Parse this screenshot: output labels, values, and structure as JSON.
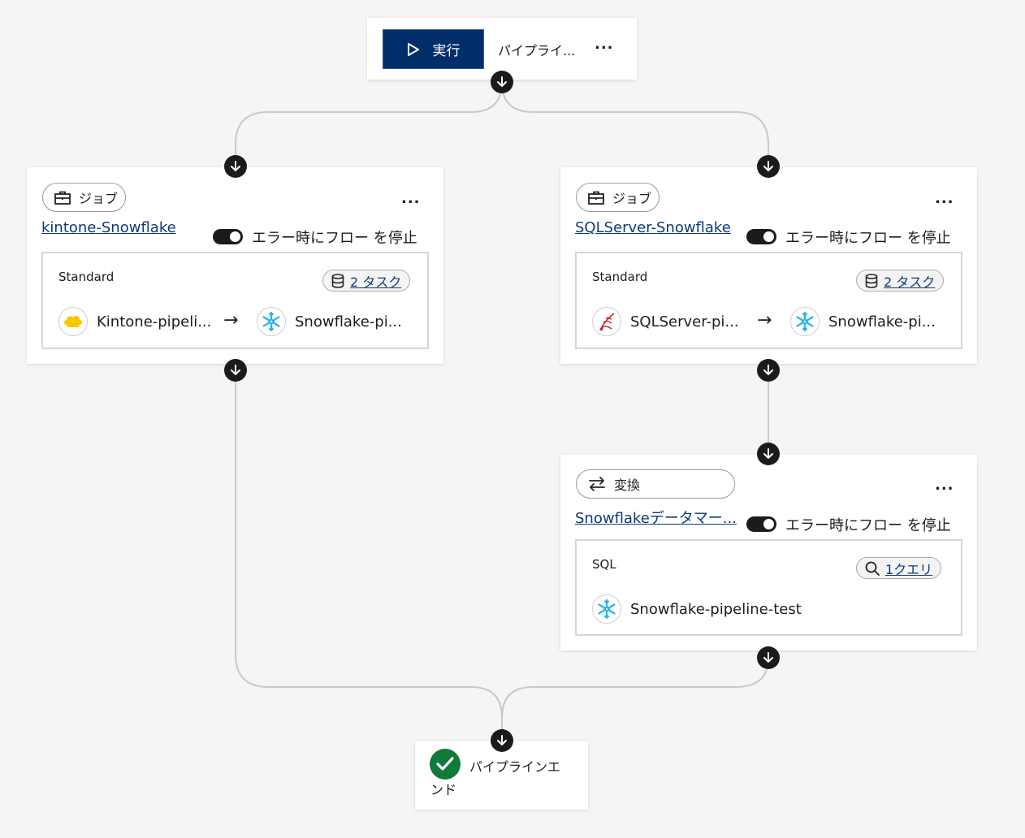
{
  "header": {
    "run_label": "実行",
    "pipeline_name": "パイプライ...",
    "more": "..."
  },
  "left_job": {
    "type_label": "ジョブ",
    "name": "kintone-Snowflake",
    "stop_on_error_label": "エラー時にフロー を停止",
    "stop_on_error": true,
    "more": "...",
    "mode": "Standard",
    "task_count": "2 タスク",
    "source": "Kintone-pipeli...",
    "target": "Snowflake-pi..."
  },
  "right_job": {
    "type_label": "ジョブ",
    "name": "SQLServer-Snowflake",
    "stop_on_error_label": "エラー時にフロー を停止",
    "stop_on_error": true,
    "more": "...",
    "mode": "Standard",
    "task_count": "2 タスク",
    "source": "SQLServer-pi...",
    "target": "Snowflake-pi..."
  },
  "transform": {
    "type_label": "変換",
    "name": "Snowflakeデータマー...",
    "stop_on_error_label": "エラー時にフロー を停止",
    "stop_on_error": true,
    "more": "...",
    "mode": "SQL",
    "query_count": "1クエリ",
    "connection": "Snowflake-pipeline-test"
  },
  "end": {
    "label_line1": "パイプラインエ",
    "label_line2": "ンド"
  },
  "colors": {
    "run_button": "#012d6b",
    "link": "#0c3a78",
    "success": "#0f7a3a",
    "background": "#f6f5f3"
  }
}
